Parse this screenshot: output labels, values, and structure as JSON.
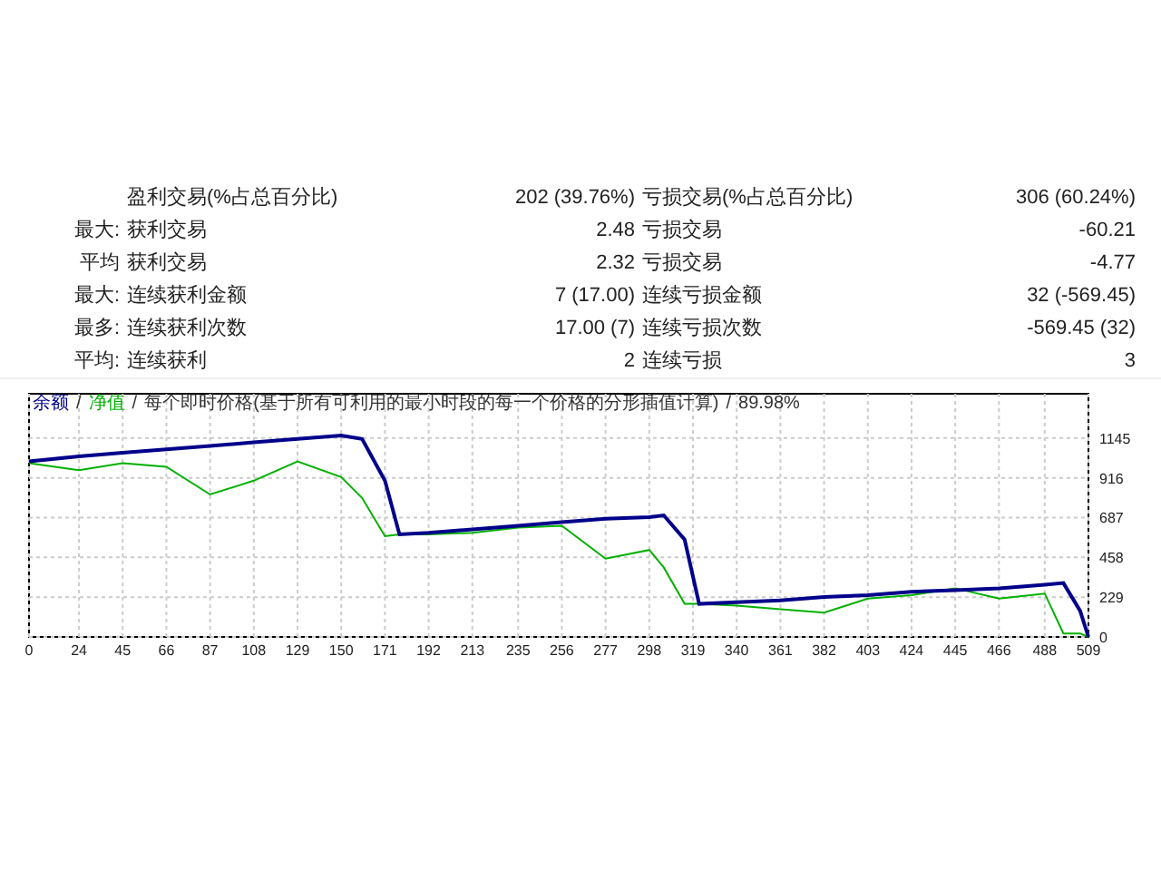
{
  "stats": [
    {
      "label_1": "盈利交易(%占总百分比)",
      "value_1": "202 (39.76%)",
      "label_2": "亏损交易(%占总百分比)",
      "value_2": "306 (60.24%)"
    },
    {
      "prefix": "最大:",
      "label_1": "获利交易",
      "value_1": "2.48",
      "label_2": "亏损交易",
      "value_2": "-60.21"
    },
    {
      "prefix": "平均",
      "label_1": "获利交易",
      "value_1": "2.32",
      "label_2": "亏损交易",
      "value_2": "-4.77"
    },
    {
      "prefix": "最大:",
      "label_1": "连续获利金额",
      "value_1": "7 (17.00)",
      "label_2": "连续亏损金额",
      "value_2": "32 (-569.45)"
    },
    {
      "prefix": "最多:",
      "label_1": "连续获利次数",
      "value_1": "17.00 (7)",
      "label_2": "连续亏损次数",
      "value_2": "-569.45 (32)"
    },
    {
      "prefix": "平均:",
      "label_1": "连续获利",
      "value_1": "2",
      "label_2": "连续亏损",
      "value_2": "3"
    }
  ],
  "chart": {
    "legend_separators": [
      "/",
      "/",
      "/"
    ],
    "legend": [
      "每个即时价格(基于所有可利用的最小时段的每一个价格的分形插值计算)",
      "89.98%"
    ],
    "chart_data": {
      "type": "line",
      "grid": true,
      "x": [
        0,
        24,
        45,
        66,
        87,
        108,
        129,
        150,
        160,
        171,
        178,
        192,
        213,
        235,
        256,
        277,
        298,
        305,
        315,
        322,
        340,
        361,
        382,
        403,
        424,
        445,
        466,
        488,
        497,
        505,
        509
      ],
      "series": [
        {
          "name": "余额",
          "color": "#00008b",
          "values": [
            1010,
            1040,
            1060,
            1080,
            1100,
            1120,
            1140,
            1160,
            1140,
            900,
            590,
            600,
            620,
            640,
            660,
            680,
            690,
            700,
            560,
            190,
            200,
            210,
            230,
            240,
            260,
            270,
            280,
            300,
            310,
            150,
            0
          ]
        },
        {
          "name": "净值",
          "color": "#00b000",
          "values": [
            1000,
            960,
            1000,
            980,
            820,
            900,
            1010,
            920,
            800,
            580,
            590,
            590,
            600,
            630,
            640,
            450,
            500,
            400,
            190,
            190,
            180,
            160,
            140,
            220,
            240,
            280,
            220,
            250,
            20,
            20,
            0
          ]
        }
      ],
      "xlim": [
        0,
        509
      ],
      "ylim": [
        0,
        1400
      ],
      "xticks": [
        0,
        24,
        45,
        66,
        87,
        108,
        129,
        150,
        171,
        192,
        213,
        235,
        256,
        277,
        298,
        319,
        340,
        361,
        382,
        403,
        424,
        445,
        466,
        488,
        509
      ],
      "yticks": [
        0,
        229,
        458,
        687,
        916,
        1145
      ]
    }
  }
}
